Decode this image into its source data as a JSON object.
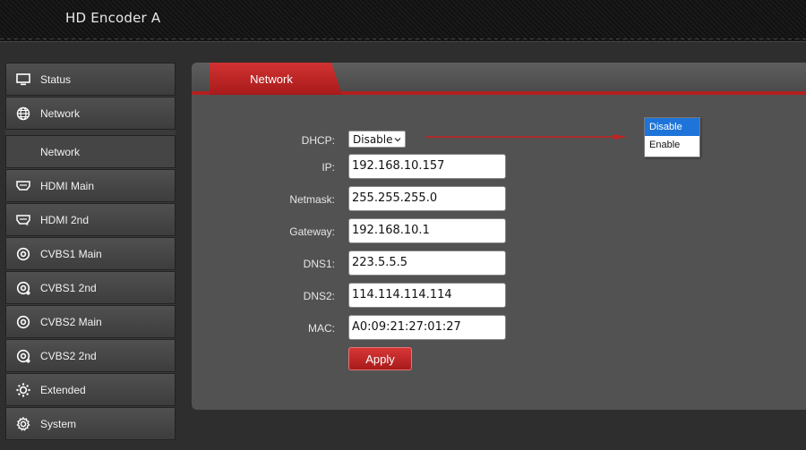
{
  "header": {
    "title": "HD Encoder  A"
  },
  "sidebar": {
    "items": [
      {
        "label": "Status",
        "icon": "monitor-icon"
      },
      {
        "label": "Network",
        "icon": "globe-icon"
      },
      {
        "label": "Network",
        "icon": ""
      },
      {
        "label": "HDMI Main",
        "icon": "hdmi-port-icon"
      },
      {
        "label": "HDMI 2nd",
        "icon": "hdmi-port-icon"
      },
      {
        "label": "CVBS1 Main",
        "icon": "rca-port-icon"
      },
      {
        "label": "CVBS1 2nd",
        "icon": "rca-port-icon"
      },
      {
        "label": "CVBS2 Main",
        "icon": "rca-port-icon"
      },
      {
        "label": "CVBS2 2nd",
        "icon": "rca-port-icon"
      },
      {
        "label": "Extended",
        "icon": "sun-gear-icon"
      },
      {
        "label": "System",
        "icon": "gear-icon"
      }
    ]
  },
  "panel": {
    "tab_label": "Network",
    "dhcp": {
      "label": "DHCP:",
      "value": "Disable"
    },
    "ip": {
      "label": "IP:",
      "value": "192.168.10.157"
    },
    "netmask": {
      "label": "Netmask:",
      "value": "255.255.255.0"
    },
    "gateway": {
      "label": "Gateway:",
      "value": "192.168.10.1"
    },
    "dns1": {
      "label": "DNS1:",
      "value": "223.5.5.5"
    },
    "dns2": {
      "label": "DNS2:",
      "value": "114.114.114.114"
    },
    "mac": {
      "label": "MAC:",
      "value": "A0:09:21:27:01:27"
    },
    "apply_label": "Apply"
  },
  "dropdown": {
    "options": [
      "Disable",
      "Enable"
    ],
    "selected": "Disable"
  },
  "colors": {
    "accent": "#c42020",
    "highlight": "#1e74d8"
  }
}
